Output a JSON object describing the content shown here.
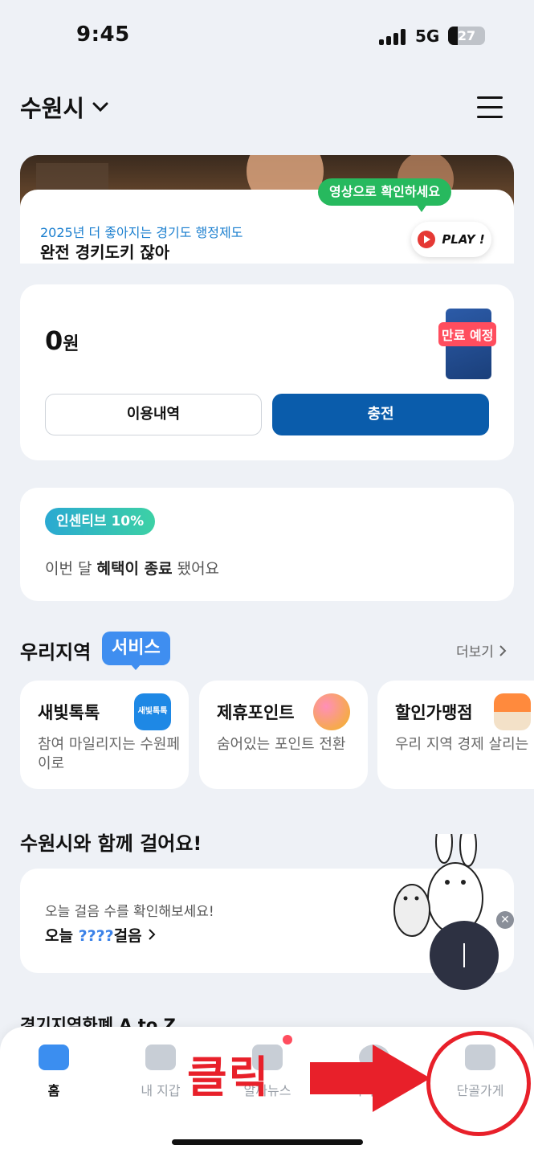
{
  "status_bar": {
    "time": "9:45",
    "network": "5G",
    "battery": "27"
  },
  "header": {
    "city": "수원시"
  },
  "banner": {
    "subtitle": "2025년 더 좋아지는 경기도 행정제도",
    "title": "완전 경키도키 잖아",
    "bubble": "영상으로 확인하세요",
    "play_label": "PLAY !"
  },
  "balance": {
    "amount": "0",
    "unit": "원",
    "expire_badge": "만료 예정",
    "history_label": "이용내역",
    "charge_label": "충전"
  },
  "incentive": {
    "badge": "인센티브 10%",
    "text_prefix": "이번 달 ",
    "text_bold": "혜택이 종료",
    "text_suffix": " 됐어요"
  },
  "region": {
    "title": "우리지역",
    "tag": "서비스",
    "more": "더보기",
    "services": [
      {
        "title": "새빛톡톡",
        "desc": "참여 마일리지는 수원페이로",
        "icon_label": "새빛톡톡"
      },
      {
        "title": "제휴포인트",
        "desc": "숨어있는 포인트 전환"
      },
      {
        "title": "할인가맹점",
        "desc": "우리 지역 경제 살리는"
      }
    ]
  },
  "walk": {
    "title": "수원시와 함께 걸어요!",
    "subtitle": "오늘 걸음 수를 확인해보세요!",
    "main_prefix": "오늘 ",
    "main_value": "????",
    "main_suffix": "걸음"
  },
  "atoz_title": "경기지역화폐 A to Z",
  "nav": {
    "items": [
      {
        "label": "홈"
      },
      {
        "label": "내 지갑"
      },
      {
        "label": "알짜뉴스"
      },
      {
        "label": "지역포털"
      },
      {
        "label": "단골가게"
      }
    ]
  },
  "annotation": {
    "click_label": "클릭"
  },
  "colors": {
    "primary": "#0a5cab",
    "accent": "#3b8ef0",
    "annotation_red": "#e8202a"
  }
}
